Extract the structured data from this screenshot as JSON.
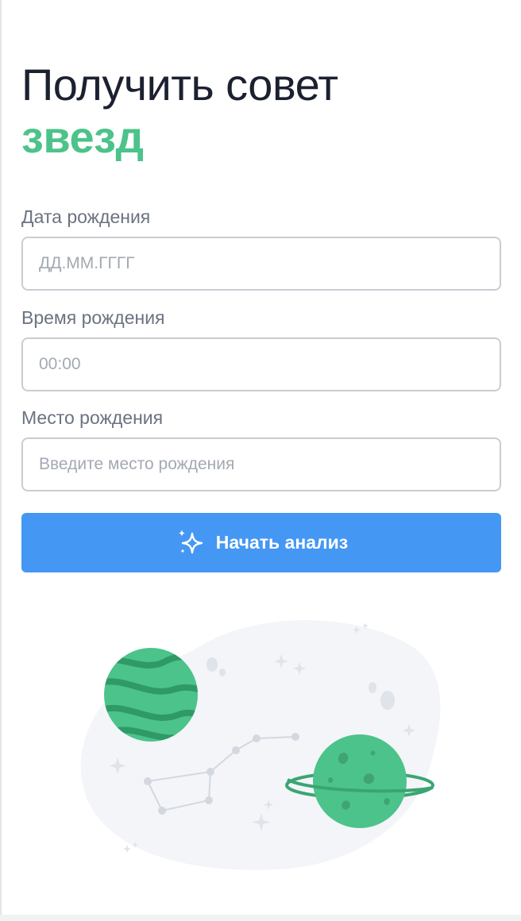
{
  "form": {
    "title_line1": "Получить совет",
    "title_line2": "звезд",
    "birth_date": {
      "label": "Дата рождения",
      "placeholder": "ДД.ММ.ГГГГ",
      "value": ""
    },
    "birth_time": {
      "label": "Время рождения",
      "placeholder": "00:00",
      "value": ""
    },
    "birth_place": {
      "label": "Место рождения",
      "placeholder": "Введите место рождения",
      "value": ""
    },
    "submit_label": "Начать анализ",
    "submit_icon": "sparkles-icon"
  },
  "colors": {
    "accent_green": "#4cc38a",
    "button_blue": "#4597f4",
    "title_dark": "#1c2130",
    "label_gray": "#6b7280"
  },
  "illustration": {
    "icons": [
      "planet-icon",
      "ringed-planet-icon",
      "constellation-icon",
      "star-icon"
    ]
  }
}
